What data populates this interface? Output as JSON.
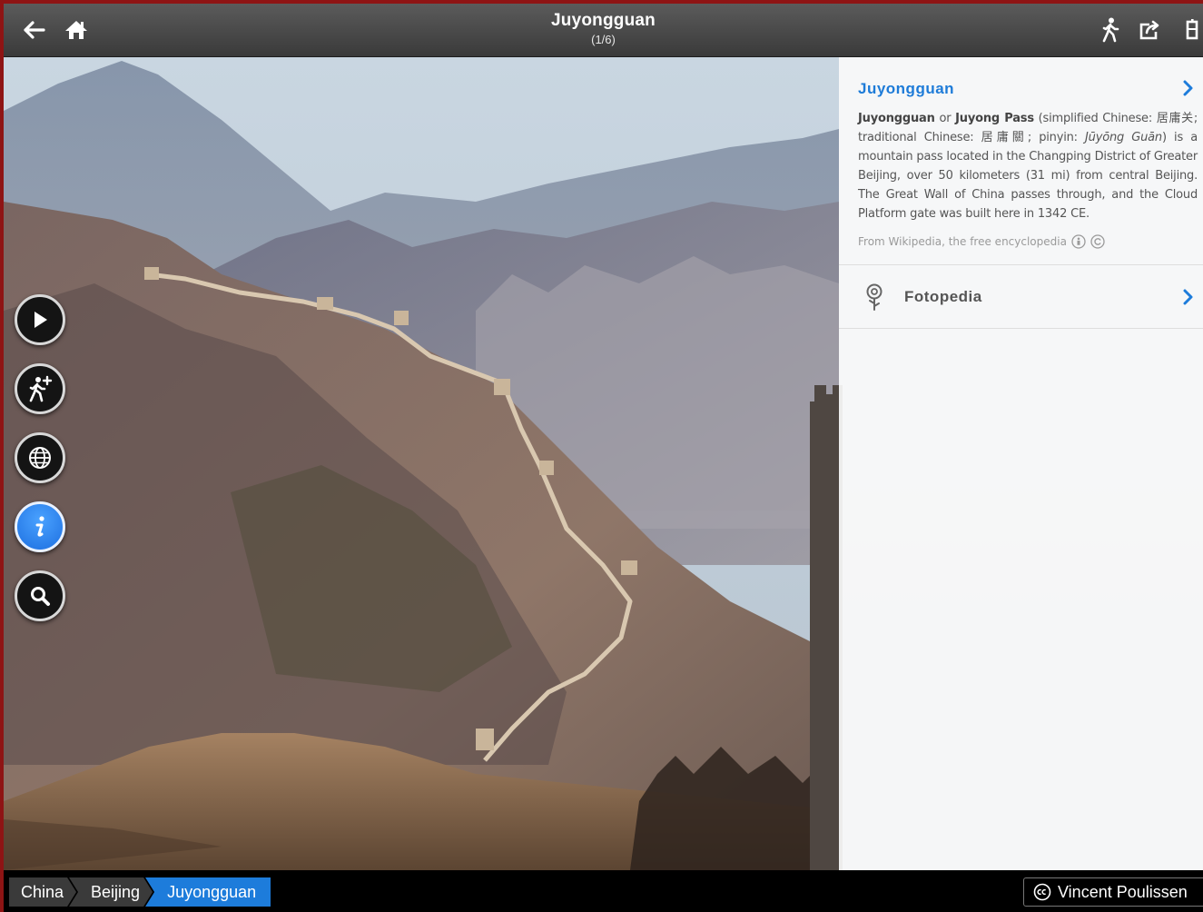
{
  "header": {
    "title": "Juyongguan",
    "subtitle": "(1/6)",
    "back_icon": "arrow-left-icon",
    "home_icon": "home-icon",
    "right_icons": [
      "walker-icon",
      "share-icon",
      "more-icon"
    ]
  },
  "sidebar": {
    "buttons": [
      {
        "name": "play",
        "icon": "play-icon"
      },
      {
        "name": "add-trip",
        "icon": "hiker-plus-icon"
      },
      {
        "name": "map",
        "icon": "globe-icon"
      },
      {
        "name": "info",
        "icon": "info-icon",
        "active": true
      },
      {
        "name": "search",
        "icon": "search-icon"
      }
    ]
  },
  "info_panel": {
    "wiki_title": "Juyongguan",
    "wiki_text_parts": {
      "name1": "Juyongguan",
      "or": " or ",
      "name2": "Juyong Pass",
      "body1": " (simplified Chinese: 居庸关; traditional Chinese: 居庸關; pinyin: ",
      "pinyin": "Jūyōng Guān",
      "body2": ") is a mountain pass located in the Changping District of Greater Beijing, over 50 kilometers (31 mi) from central Beijing. The Great Wall of China passes through, and the Cloud Platform gate was built here in 1342 CE."
    },
    "wiki_source": "From Wikipedia, the free encyclopedia",
    "fotopedia_label": "Fotopedia"
  },
  "breadcrumb": {
    "items": [
      "China",
      "Beijing",
      "Juyongguan"
    ],
    "active_index": 2
  },
  "credit": {
    "license_icon": "cc-icon",
    "author": "Vincent Poulissen"
  },
  "colors": {
    "accent": "#1d7cdb",
    "frame": "#8e1414",
    "topbar": "#4a4a4a"
  }
}
